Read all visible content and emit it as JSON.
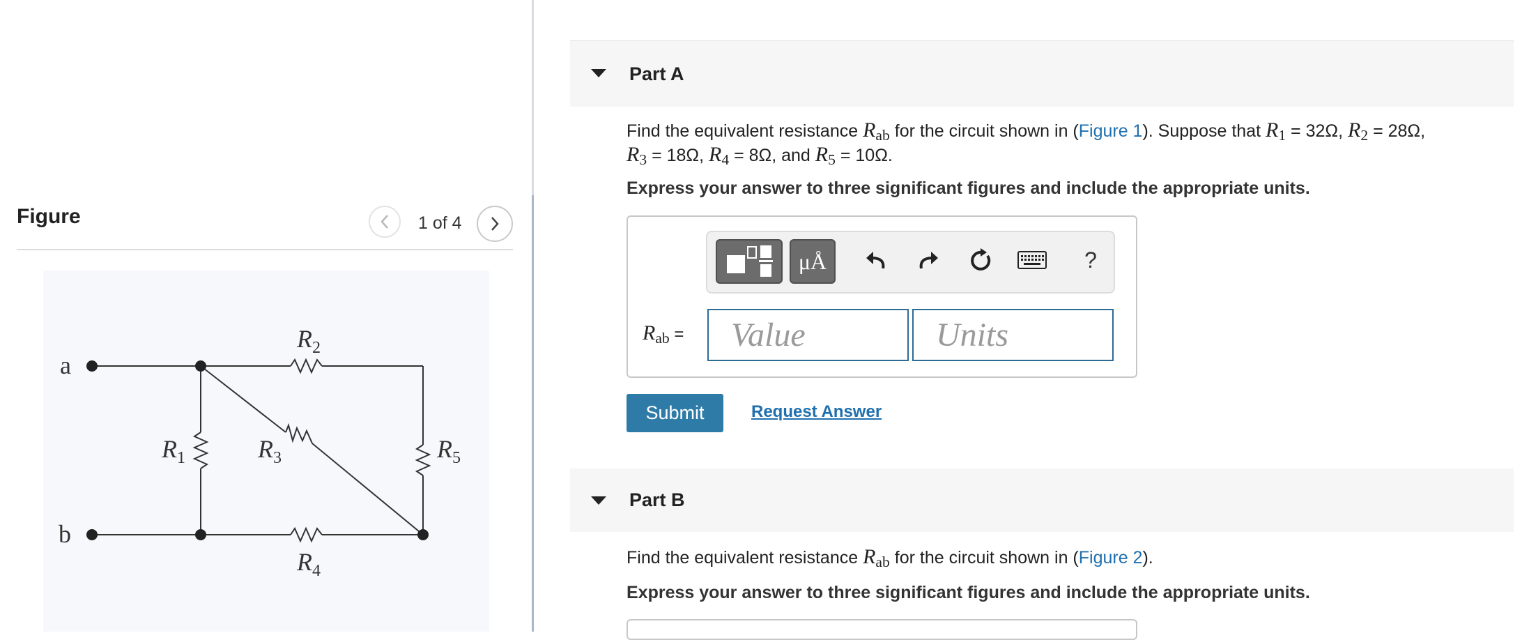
{
  "figure": {
    "heading": "Figure",
    "counter": "1 of 4",
    "circuit": {
      "terminal_a": "a",
      "terminal_b": "b",
      "r1": "R",
      "r1_sub": "1",
      "r2": "R",
      "r2_sub": "2",
      "r3": "R",
      "r3_sub": "3",
      "r4": "R",
      "r4_sub": "4",
      "r5": "R",
      "r5_sub": "5"
    }
  },
  "partA": {
    "title": "Part A",
    "q_prefix": "Find the equivalent resistance ",
    "q_symbol": "R",
    "q_symbol_sub": "ab",
    "q_mid": " for the circuit shown in (",
    "q_link": "Figure 1",
    "q_after": "). Suppose that ",
    "r1_sym": "R",
    "r1_sub": "1",
    "r1_val": " = 32Ω, ",
    "r2_sym": "R",
    "r2_sub": "2",
    "r2_val": " = 28Ω,",
    "r3_sym": "R",
    "r3_sub": "3",
    "r3_val": " = 18Ω, ",
    "r4_sym": "R",
    "r4_sub": "4",
    "r4_val": " = 8Ω, and ",
    "r5_sym": "R",
    "r5_sub": "5",
    "r5_val": " = 10Ω.",
    "instruction": "Express your answer to three significant figures and include the appropriate units.",
    "toolbar": {
      "templates_icon": "templates-icon",
      "units_label": "μÅ",
      "undo_icon": "undo-icon",
      "redo_icon": "redo-icon",
      "reset_icon": "reset-icon",
      "keyboard_icon": "keyboard-icon",
      "help_label": "?"
    },
    "answer_label": "R",
    "answer_label_sub": "ab",
    "answer_equals": " =",
    "value_placeholder": "Value",
    "units_placeholder": "Units",
    "submit_label": "Submit",
    "request_answer_label": "Request Answer"
  },
  "partB": {
    "title": "Part B",
    "q_prefix": "Find the equivalent resistance ",
    "q_symbol": "R",
    "q_symbol_sub": "ab",
    "q_mid": " for the circuit shown in (",
    "q_link": "Figure 2",
    "q_after": ").",
    "instruction": "Express your answer to three significant figures and include the appropriate units."
  },
  "colors": {
    "accent_blue": "#2f7ba8",
    "link_blue": "#1f6fae",
    "header_bg": "#f6f6f6"
  }
}
